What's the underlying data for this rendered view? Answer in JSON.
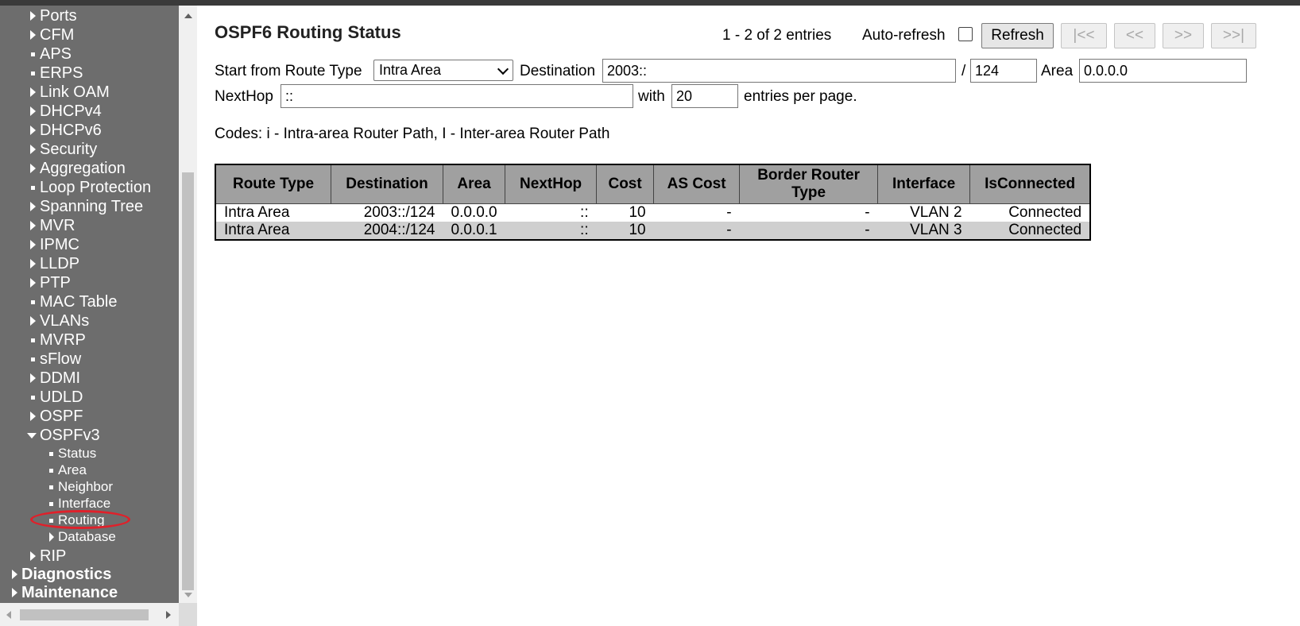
{
  "sidebar": {
    "items": [
      {
        "label": "Ports",
        "marker": "arrow"
      },
      {
        "label": "CFM",
        "marker": "arrow"
      },
      {
        "label": "APS",
        "marker": "square"
      },
      {
        "label": "ERPS",
        "marker": "square"
      },
      {
        "label": "Link OAM",
        "marker": "arrow"
      },
      {
        "label": "DHCPv4",
        "marker": "arrow"
      },
      {
        "label": "DHCPv6",
        "marker": "arrow"
      },
      {
        "label": "Security",
        "marker": "arrow"
      },
      {
        "label": "Aggregation",
        "marker": "arrow"
      },
      {
        "label": "Loop Protection",
        "marker": "square"
      },
      {
        "label": "Spanning Tree",
        "marker": "arrow"
      },
      {
        "label": "MVR",
        "marker": "arrow"
      },
      {
        "label": "IPMC",
        "marker": "arrow"
      },
      {
        "label": "LLDP",
        "marker": "arrow"
      },
      {
        "label": "PTP",
        "marker": "arrow"
      },
      {
        "label": "MAC Table",
        "marker": "square"
      },
      {
        "label": "VLANs",
        "marker": "arrow"
      },
      {
        "label": "MVRP",
        "marker": "square"
      },
      {
        "label": "sFlow",
        "marker": "square"
      },
      {
        "label": "DDMI",
        "marker": "arrow"
      },
      {
        "label": "UDLD",
        "marker": "square"
      },
      {
        "label": "OSPF",
        "marker": "arrow"
      },
      {
        "label": "OSPFv3",
        "marker": "arrow-down"
      }
    ],
    "ospfv3_sub": [
      {
        "label": "Status",
        "marker": "square"
      },
      {
        "label": "Area",
        "marker": "square"
      },
      {
        "label": "Neighbor",
        "marker": "square"
      },
      {
        "label": "Interface",
        "marker": "square"
      },
      {
        "label": "Routing",
        "marker": "square"
      },
      {
        "label": "Database",
        "marker": "arrow"
      }
    ],
    "after": [
      {
        "label": "RIP",
        "marker": "arrow"
      }
    ],
    "sections": [
      {
        "label": "Diagnostics",
        "marker": "arrow"
      },
      {
        "label": "Maintenance",
        "marker": "arrow"
      }
    ]
  },
  "page": {
    "title": "OSPF6 Routing Status",
    "entries_info": "1 - 2 of 2 entries",
    "auto_refresh_label": "Auto-refresh",
    "auto_refresh_checked": false,
    "buttons": {
      "refresh": "Refresh",
      "first": "|<<",
      "prev": "<<",
      "next": ">>",
      "last": ">>|"
    }
  },
  "filter": {
    "start_label": "Start from Route Type",
    "route_type_value": "Intra Area",
    "destination_label": "Destination",
    "destination_value": "2003::",
    "slash": "/",
    "prefix_value": "124",
    "area_label": "Area",
    "area_value": "0.0.0.0",
    "nexthop_label": "NextHop",
    "nexthop_value": "::",
    "with_label": "with",
    "per_page_value": "20",
    "per_page_suffix": "entries per page."
  },
  "codes": "Codes: i - Intra-area Router Path, I - Inter-area Router Path",
  "table": {
    "headers": [
      "Route Type",
      "Destination",
      "Area",
      "NextHop",
      "Cost",
      "AS Cost",
      "Border Router Type",
      "Interface",
      "IsConnected"
    ],
    "rows": [
      [
        "Intra Area",
        "2003::/124",
        "0.0.0.0",
        "::",
        "10",
        "-",
        "-",
        "VLAN 2",
        "Connected"
      ],
      [
        "Intra Area",
        "2004::/124",
        "0.0.0.1",
        "::",
        "10",
        "-",
        "-",
        "VLAN 3",
        "Connected"
      ]
    ]
  }
}
